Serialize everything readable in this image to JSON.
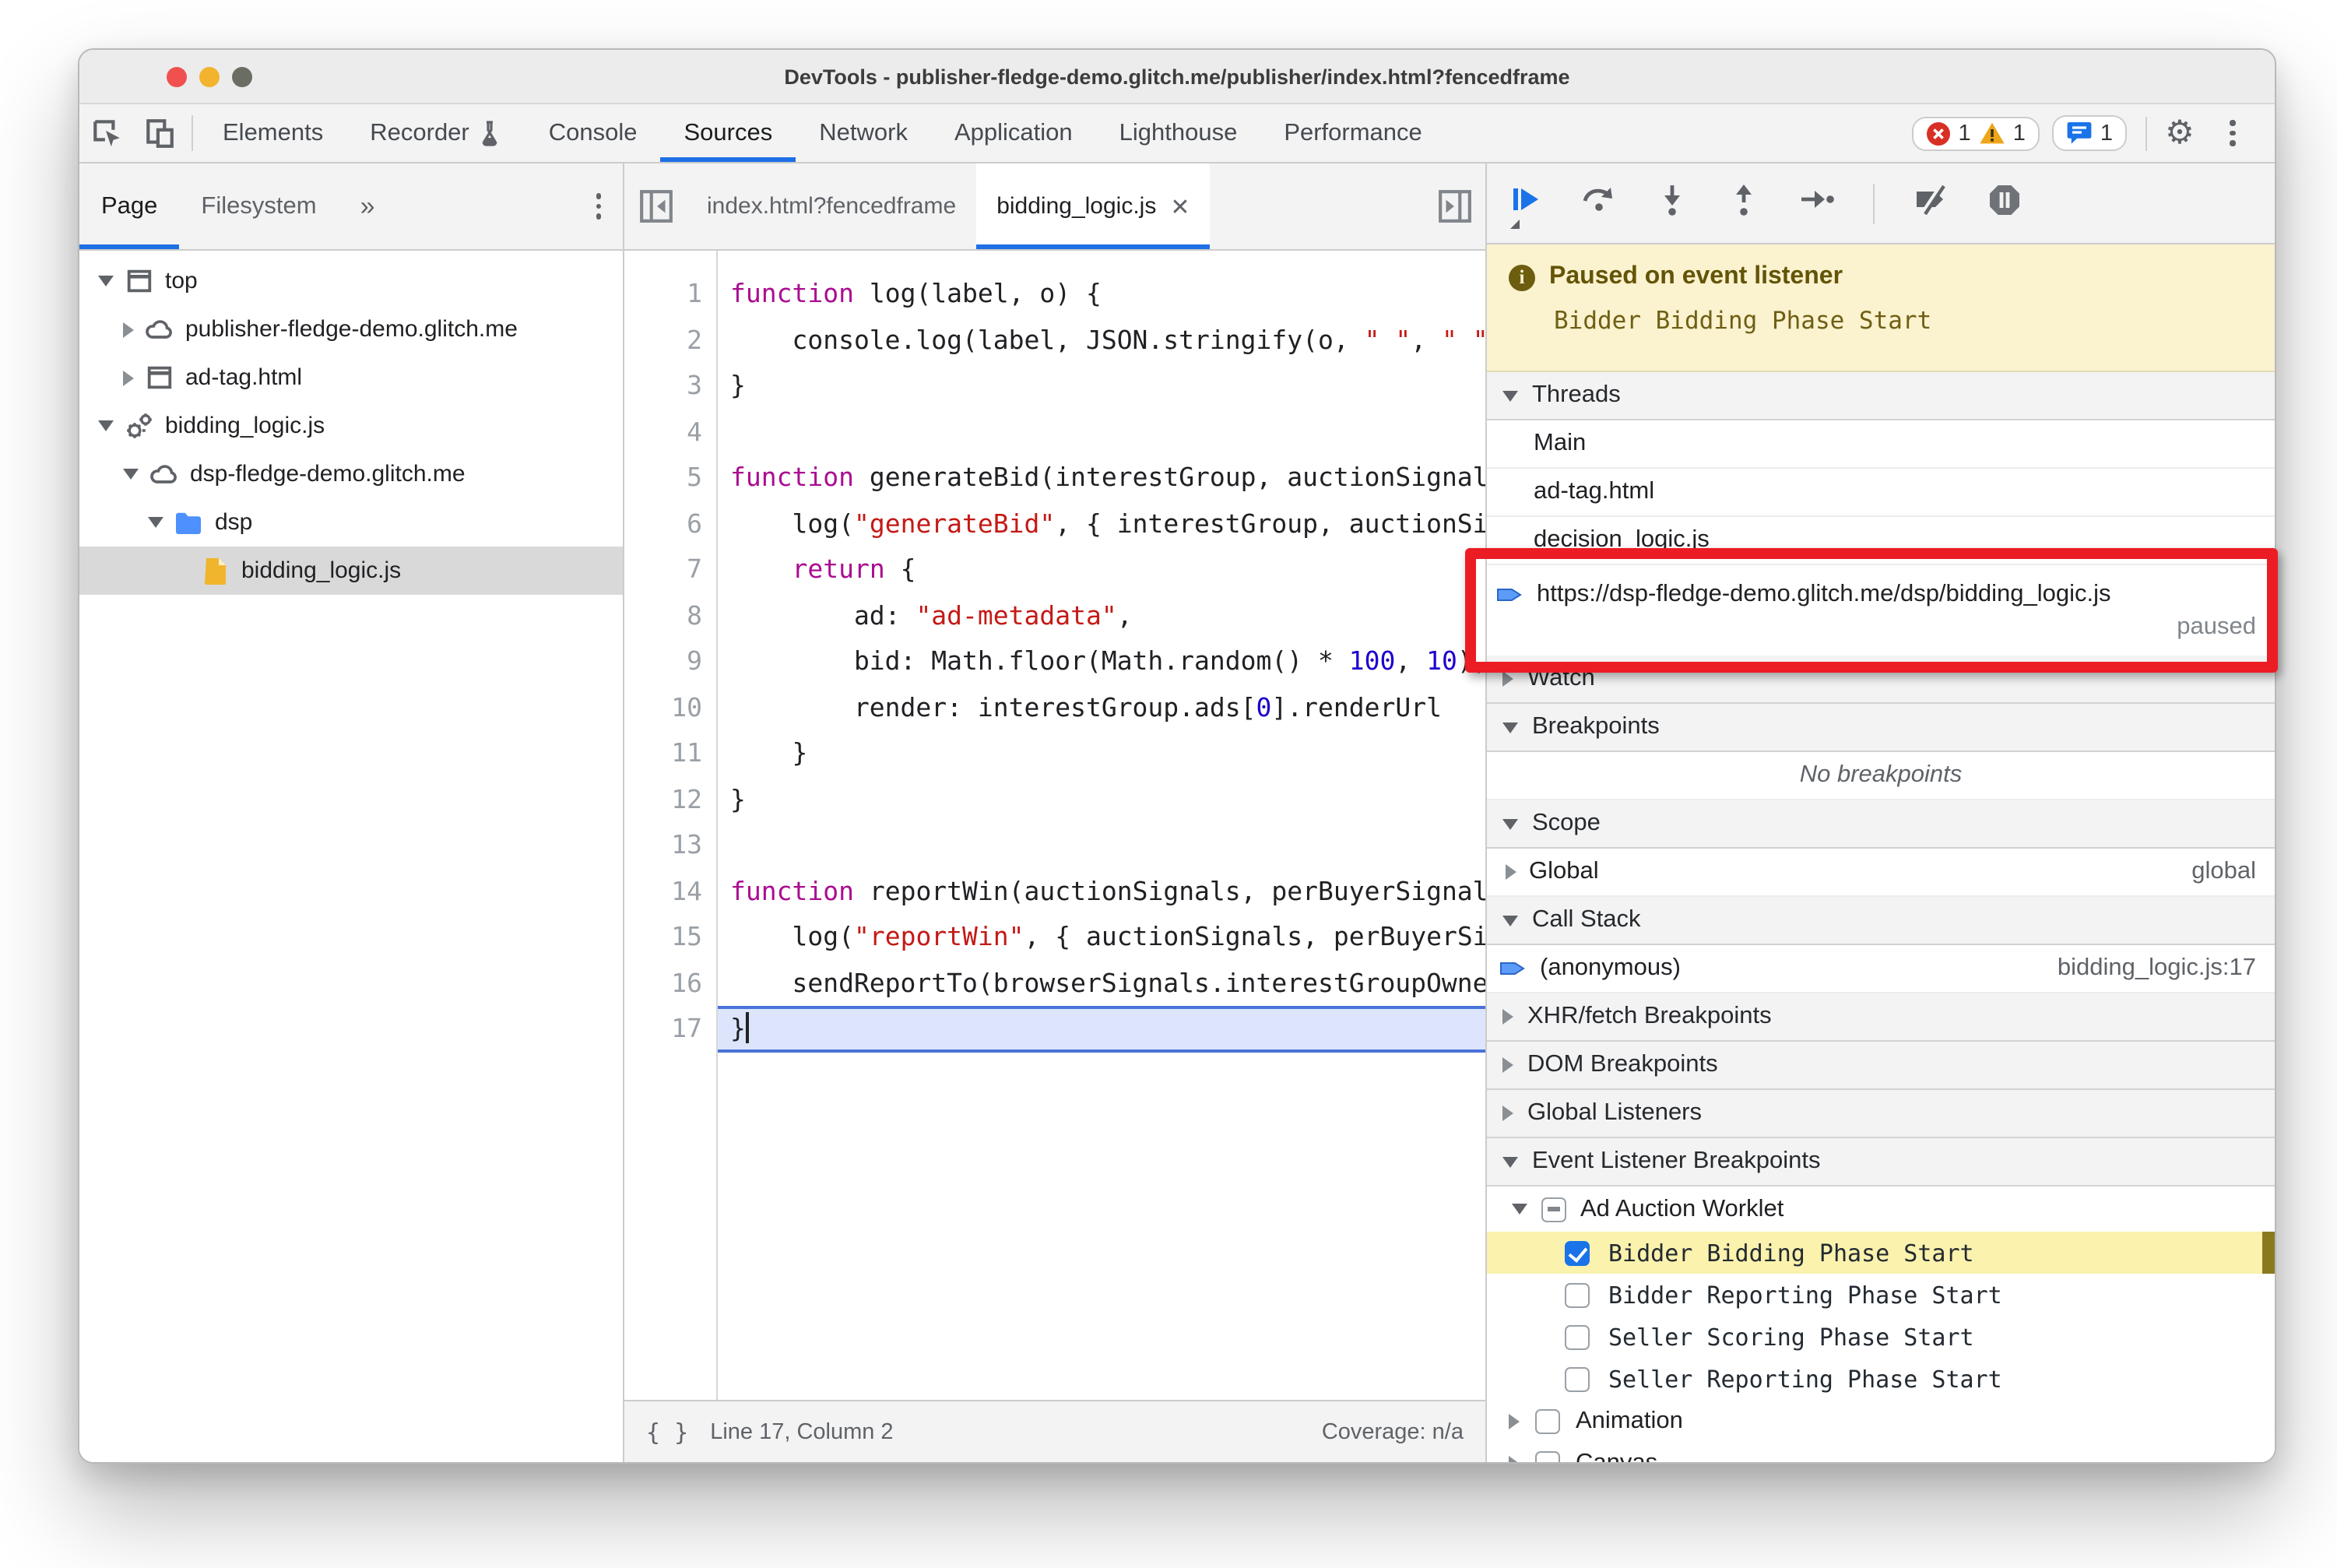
{
  "window": {
    "title": "DevTools - publisher-fledge-demo.glitch.me/publisher/index.html?fencedframe"
  },
  "toolbar": {
    "tabs": [
      {
        "label": "Elements"
      },
      {
        "label": "Recorder",
        "flask": true
      },
      {
        "label": "Console"
      },
      {
        "label": "Sources",
        "selected": true
      },
      {
        "label": "Network"
      },
      {
        "label": "Application"
      },
      {
        "label": "Lighthouse"
      },
      {
        "label": "Performance"
      }
    ],
    "more_tabs_symbol": "»",
    "error_count": "1",
    "warning_count": "1",
    "message_count": "1"
  },
  "sidebar": {
    "tabs": [
      {
        "label": "Page",
        "selected": true
      },
      {
        "label": "Filesystem"
      }
    ],
    "more_symbol": "»",
    "tree": [
      {
        "label": "top",
        "icon": "frame",
        "arrow": "down",
        "level": 0
      },
      {
        "label": "publisher-fledge-demo.glitch.me",
        "icon": "cloud",
        "arrow": "right",
        "level": 1
      },
      {
        "label": "ad-tag.html",
        "icon": "frame",
        "arrow": "right",
        "level": 1
      },
      {
        "label": "bidding_logic.js",
        "icon": "gears",
        "arrow": "down",
        "level": 0
      },
      {
        "label": "dsp-fledge-demo.glitch.me",
        "icon": "cloud",
        "arrow": "down",
        "level": 1
      },
      {
        "label": "dsp",
        "icon": "folder",
        "arrow": "down",
        "level": 2
      },
      {
        "label": "bidding_logic.js",
        "icon": "file",
        "arrow": "none",
        "level": 3,
        "selected": true
      }
    ]
  },
  "editor": {
    "tabs": [
      {
        "label": "index.html?fencedframe"
      },
      {
        "label": "bidding_logic.js",
        "active": true,
        "closable": true
      }
    ],
    "status": {
      "cursor": "Line 17, Column 2",
      "coverage": "Coverage: n/a"
    },
    "lines": [
      {
        "n": 1,
        "t": [
          [
            "k",
            "function"
          ],
          [
            "p",
            " log(label, o) {"
          ]
        ]
      },
      {
        "n": 2,
        "t": [
          [
            "p",
            "    console.log(label, JSON.stringify(o, "
          ],
          [
            "s",
            "\" \""
          ],
          [
            "p",
            ", "
          ],
          [
            "s",
            "\" \""
          ],
          [
            "p",
            "));"
          ]
        ]
      },
      {
        "n": 3,
        "t": [
          [
            "p",
            "}"
          ]
        ]
      },
      {
        "n": 4,
        "t": []
      },
      {
        "n": 5,
        "t": [
          [
            "k",
            "function"
          ],
          [
            "p",
            " generateBid(interestGroup, auctionSignals, perBuyerSignals, trustedBiddingSignals, browserSignals) {"
          ]
        ]
      },
      {
        "n": 6,
        "t": [
          [
            "p",
            "    log("
          ],
          [
            "s",
            "\"generateBid\""
          ],
          [
            "p",
            ", { interestGroup, auctionSignals, perBuyerSignals, trustedBiddingSignals, browserSignals });"
          ]
        ]
      },
      {
        "n": 7,
        "t": [
          [
            "p",
            "    "
          ],
          [
            "k",
            "return"
          ],
          [
            "p",
            " {"
          ]
        ]
      },
      {
        "n": 8,
        "t": [
          [
            "p",
            "        ad: "
          ],
          [
            "s",
            "\"ad-metadata\""
          ],
          [
            "p",
            ","
          ]
        ]
      },
      {
        "n": 9,
        "t": [
          [
            "p",
            "        bid: Math.floor(Math.random() * "
          ],
          [
            "n",
            "100"
          ],
          [
            "p",
            ", "
          ],
          [
            "n",
            "10"
          ],
          [
            "p",
            "),"
          ]
        ]
      },
      {
        "n": 10,
        "t": [
          [
            "p",
            "        render: interestGroup.ads["
          ],
          [
            "n",
            "0"
          ],
          [
            "p",
            "].renderUrl"
          ]
        ]
      },
      {
        "n": 11,
        "t": [
          [
            "p",
            "    }"
          ]
        ]
      },
      {
        "n": 12,
        "t": [
          [
            "p",
            "}"
          ]
        ]
      },
      {
        "n": 13,
        "t": []
      },
      {
        "n": 14,
        "t": [
          [
            "k",
            "function"
          ],
          [
            "p",
            " reportWin(auctionSignals, perBuyerSignals, sellerSignals, browserSignals) {"
          ]
        ]
      },
      {
        "n": 15,
        "t": [
          [
            "p",
            "    log("
          ],
          [
            "s",
            "\"reportWin\""
          ],
          [
            "p",
            ", { auctionSignals, perBuyerSignals, sellerSignals, browserSignals });"
          ]
        ]
      },
      {
        "n": 16,
        "t": [
          [
            "p",
            "    sendReportTo(browserSignals.interestGroupOwner);"
          ]
        ]
      },
      {
        "n": 17,
        "t": [
          [
            "p",
            "}"
          ]
        ],
        "exec": true
      }
    ]
  },
  "debugger": {
    "banner": {
      "title": "Paused on event listener",
      "subtitle": "Bidder Bidding Phase Start"
    },
    "sections": [
      {
        "kind": "header",
        "arrow": "down",
        "label": "Threads"
      },
      {
        "kind": "thread",
        "label": "Main"
      },
      {
        "kind": "thread",
        "label": "ad-tag.html"
      },
      {
        "kind": "thread",
        "label": "decision_logic.js"
      },
      {
        "kind": "thread-active",
        "url": "https://dsp-fledge-demo.glitch.me/dsp/bidding_logic.js",
        "status": "paused"
      },
      {
        "kind": "header",
        "arrow": "right",
        "label": "Watch"
      },
      {
        "kind": "header",
        "arrow": "down",
        "label": "Breakpoints"
      },
      {
        "kind": "empty",
        "label": "No breakpoints"
      },
      {
        "kind": "header",
        "arrow": "down",
        "label": "Scope"
      },
      {
        "kind": "scope",
        "label": "Global",
        "value": "global"
      },
      {
        "kind": "header",
        "arrow": "down",
        "label": "Call Stack"
      },
      {
        "kind": "stack",
        "label": "(anonymous)",
        "location": "bidding_logic.js:17"
      },
      {
        "kind": "header",
        "arrow": "right",
        "label": "XHR/fetch Breakpoints"
      },
      {
        "kind": "header",
        "arrow": "right",
        "label": "DOM Breakpoints"
      },
      {
        "kind": "header",
        "arrow": "right",
        "label": "Global Listeners"
      },
      {
        "kind": "header",
        "arrow": "down",
        "label": "Event Listener Breakpoints"
      },
      {
        "kind": "group",
        "arrow": "down",
        "label": "Ad Auction Worklet",
        "checkbox": "indeterminate"
      },
      {
        "kind": "check",
        "label": "Bidder Bidding Phase Start",
        "checked": true,
        "highlighted": true
      },
      {
        "kind": "check",
        "label": "Bidder Reporting Phase Start",
        "checked": false
      },
      {
        "kind": "check",
        "label": "Seller Scoring Phase Start",
        "checked": false
      },
      {
        "kind": "check",
        "label": "Seller Reporting Phase Start",
        "checked": false
      },
      {
        "kind": "group2",
        "arrow": "right",
        "label": "Animation",
        "checked": false
      },
      {
        "kind": "group2",
        "arrow": "right",
        "label": "Canvas",
        "checked": false
      }
    ]
  }
}
